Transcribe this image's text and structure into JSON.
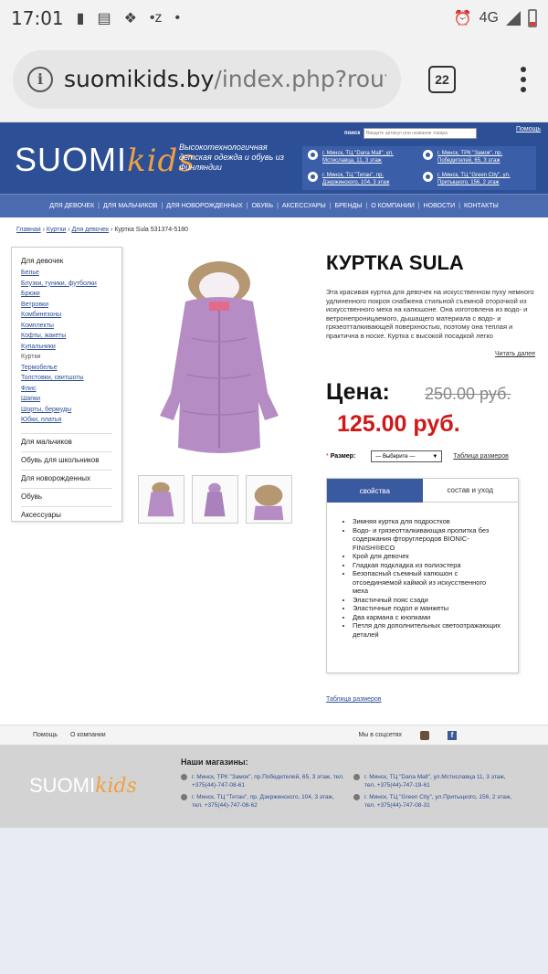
{
  "status_bar": {
    "time": "17:01",
    "network": "4G"
  },
  "browser": {
    "url_host": "suomikids.by",
    "url_path": "/index.php?rout",
    "tab_count": "22"
  },
  "header": {
    "logo_text": "SUOMI",
    "logo_kids": "kids",
    "tagline": "Высокотехнологичная детская одежда и обувь из Финляндии",
    "search_label": "поиск",
    "search_placeholder": "Введите артикул или название товара",
    "help_link": "Помощь",
    "stores": [
      "г. Минск, ТЦ \"Dana Mall\", ул. Мстиславца, 11, 3 этаж",
      "г. Минск, ТРК \"Замок\", пр. Победителей, 65, 3 этаж",
      "г. Минск, ТЦ \"Титан\", пр. Дзержинского, 104, 3 этаж",
      "г. Минск, ТЦ \"Green City\", ул. Притыцкого, 156, 2 этаж"
    ]
  },
  "nav": [
    "ДЛЯ ДЕВОЧЕК",
    "ДЛЯ МАЛЬЧИКОВ",
    "ДЛЯ НОВОРОЖДЕННЫХ",
    "ОБУВЬ",
    "АКСЕССУАРЫ",
    "БРЕНДЫ",
    "О КОМПАНИИ",
    "НОВОСТИ",
    "КОНТАКТЫ"
  ],
  "breadcrumb": {
    "items": [
      "Главная",
      "Куртки",
      "Для девочек"
    ],
    "current": "Куртка Sula 531374-5180"
  },
  "sidebar": {
    "current_category": "Для девочек",
    "subcategories": [
      "Белье",
      "Блузки, туники, футболки",
      "Брюки",
      "Ветровки",
      "Комбинезоны",
      "Комплекты",
      "Кофты, жакеты",
      "Купальники",
      "Куртки",
      "Термобелье",
      "Толстовки, свитшоты",
      "Флис",
      "Шапки",
      "Шорты, бермуды",
      "Юбки, платья"
    ],
    "categories": [
      "Для мальчиков",
      "Обувь для школьников",
      "Для новорожденных",
      "Обувь",
      "Аксессуары"
    ]
  },
  "product": {
    "title": "КУРТКА SULA",
    "description": "Эта красивая куртка для девочек на искусственном пуху немного удлиненного покроя снабжена стильной съемной оторочкой из искусственного меха на капюшоне. Она изготовлена из водо- и ветронепроницаемого, дышащего материала с водо- и грязеотталкивающей поверхностью, поэтому она теплая и практична в носке. Куртка с высокой посадкой легко",
    "read_more": "Читать далее",
    "price_label": "Цена:",
    "old_price": "250.00 руб.",
    "new_price": "125.00 руб.",
    "size_label": "Размер:",
    "size_select": "— Выберите —",
    "size_table_link": "Таблица размеров",
    "tabs": [
      "свойства",
      "состав и уход"
    ],
    "features": [
      "Зимняя куртка для подростков",
      "Водо- и грязеотталкивающая пропитка без содержания фторуглеродов BIONIC-FINISH®ECO",
      "Крой для девочек",
      "Гладкая подкладка из полиэстера",
      "Безопасный съемный капюшон с отсоединяемой каймой из искусственного меха",
      "Эластичный пояс сзади",
      "Эластичные подол и манжеты",
      "Два кармана с кнопками",
      "Петля для дополнительных светоотражающих деталей"
    ],
    "bottom_size_link": "Таблица размеров"
  },
  "footer": {
    "links": [
      "Помощь",
      "О компании"
    ],
    "social_label": "Мы в соцсетях",
    "stores_heading": "Наши магазины:",
    "stores": [
      "г. Минск, ТРК \"Замок\", пр.Победителей, 65, 3 этаж, тел. +375(44)-747-08-61",
      "г. Минск, ТЦ \"Dana Mall\", ул.Мстиславца 11, 3 этаж, тел. +375(44)-747-19-61",
      "г. Минск, ТЦ \"Титан\", пр. Дзержинского, 104, 3 этаж, тел. +375(44)-747-08-62",
      "г. Минск, ТЦ \"Green City\", ул.Притыцкого, 156, 2 этаж, тел. +375(44)-747-08-31"
    ]
  }
}
